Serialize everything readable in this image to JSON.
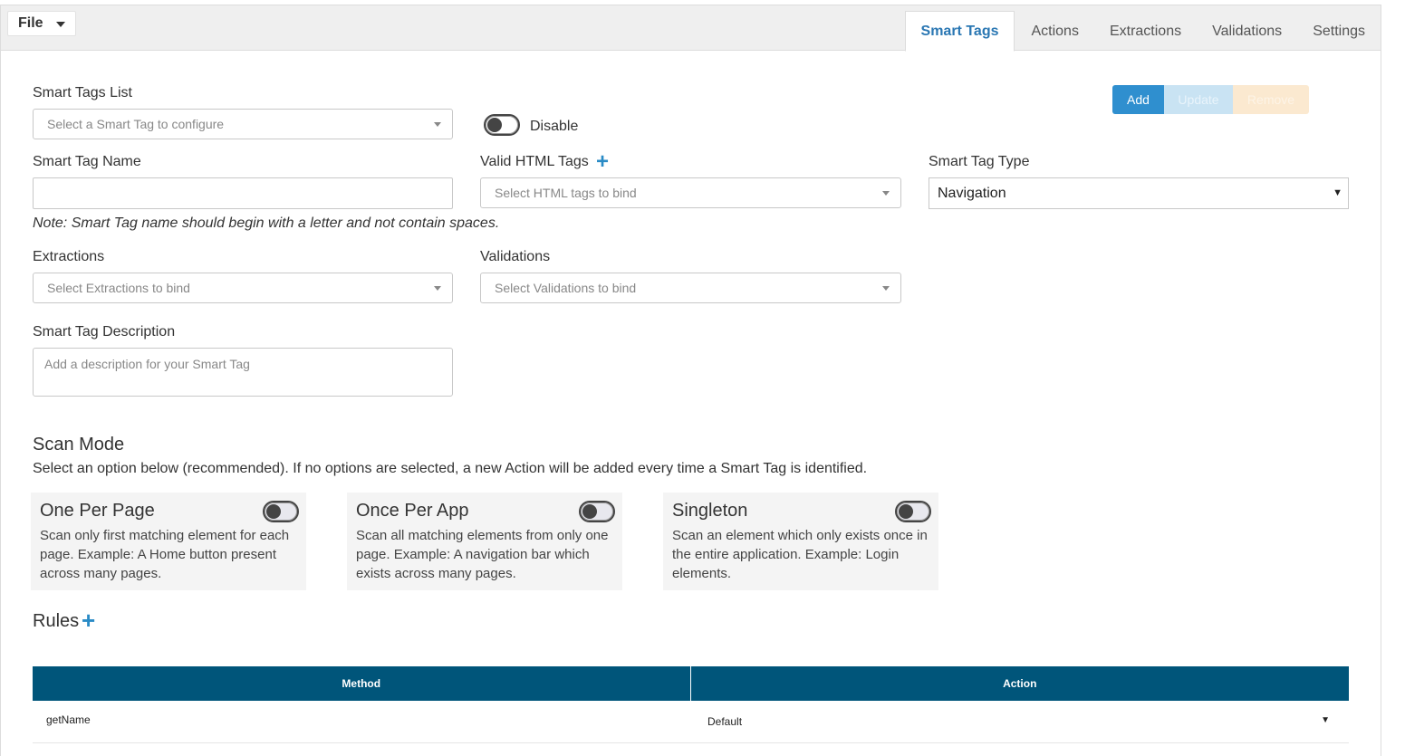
{
  "menu": {
    "file_label": "File"
  },
  "tabs": [
    {
      "label": "Smart Tags",
      "active": true
    },
    {
      "label": "Actions",
      "active": false
    },
    {
      "label": "Extractions",
      "active": false
    },
    {
      "label": "Validations",
      "active": false
    },
    {
      "label": "Settings",
      "active": false
    }
  ],
  "toolbar": {
    "add_label": "Add",
    "update_label": "Update",
    "remove_label": "Remove"
  },
  "form": {
    "smart_tags_list_label": "Smart Tags List",
    "smart_tags_list_placeholder": "Select a Smart Tag to configure",
    "disable_label": "Disable",
    "smart_tag_name_label": "Smart Tag Name",
    "smart_tag_name_value": "",
    "name_note": "Note: Smart Tag name should begin with a letter and not contain spaces.",
    "valid_html_tags_label": "Valid HTML Tags",
    "valid_html_tags_placeholder": "Select HTML tags to bind",
    "smart_tag_type_label": "Smart Tag Type",
    "smart_tag_type_value": "Navigation",
    "extractions_label": "Extractions",
    "extractions_placeholder": "Select Extractions to bind",
    "validations_label": "Validations",
    "validations_placeholder": "Select Validations to bind",
    "description_label": "Smart Tag Description",
    "description_placeholder": "Add a description for your Smart Tag"
  },
  "scan_mode": {
    "title": "Scan Mode",
    "description": "Select an option below (recommended). If no options are selected, a new Action will be added every time a Smart Tag is identified.",
    "options": [
      {
        "title": "One Per Page",
        "text": "Scan only first matching element for each page. Example: A Home button present across many pages."
      },
      {
        "title": "Once Per App",
        "text": "Scan all matching elements from only one page. Example: A navigation bar which exists across many pages."
      },
      {
        "title": "Singleton",
        "text": "Scan an element which only exists once in the entire application. Example: Login elements."
      }
    ]
  },
  "rules": {
    "title": "Rules",
    "columns": [
      "Method",
      "Action"
    ],
    "rows": [
      {
        "method": "getName",
        "action": "Default"
      }
    ]
  },
  "colors": {
    "accent": "#2a77b3",
    "table_header": "#00557a",
    "plus": "#2a8bc6"
  }
}
